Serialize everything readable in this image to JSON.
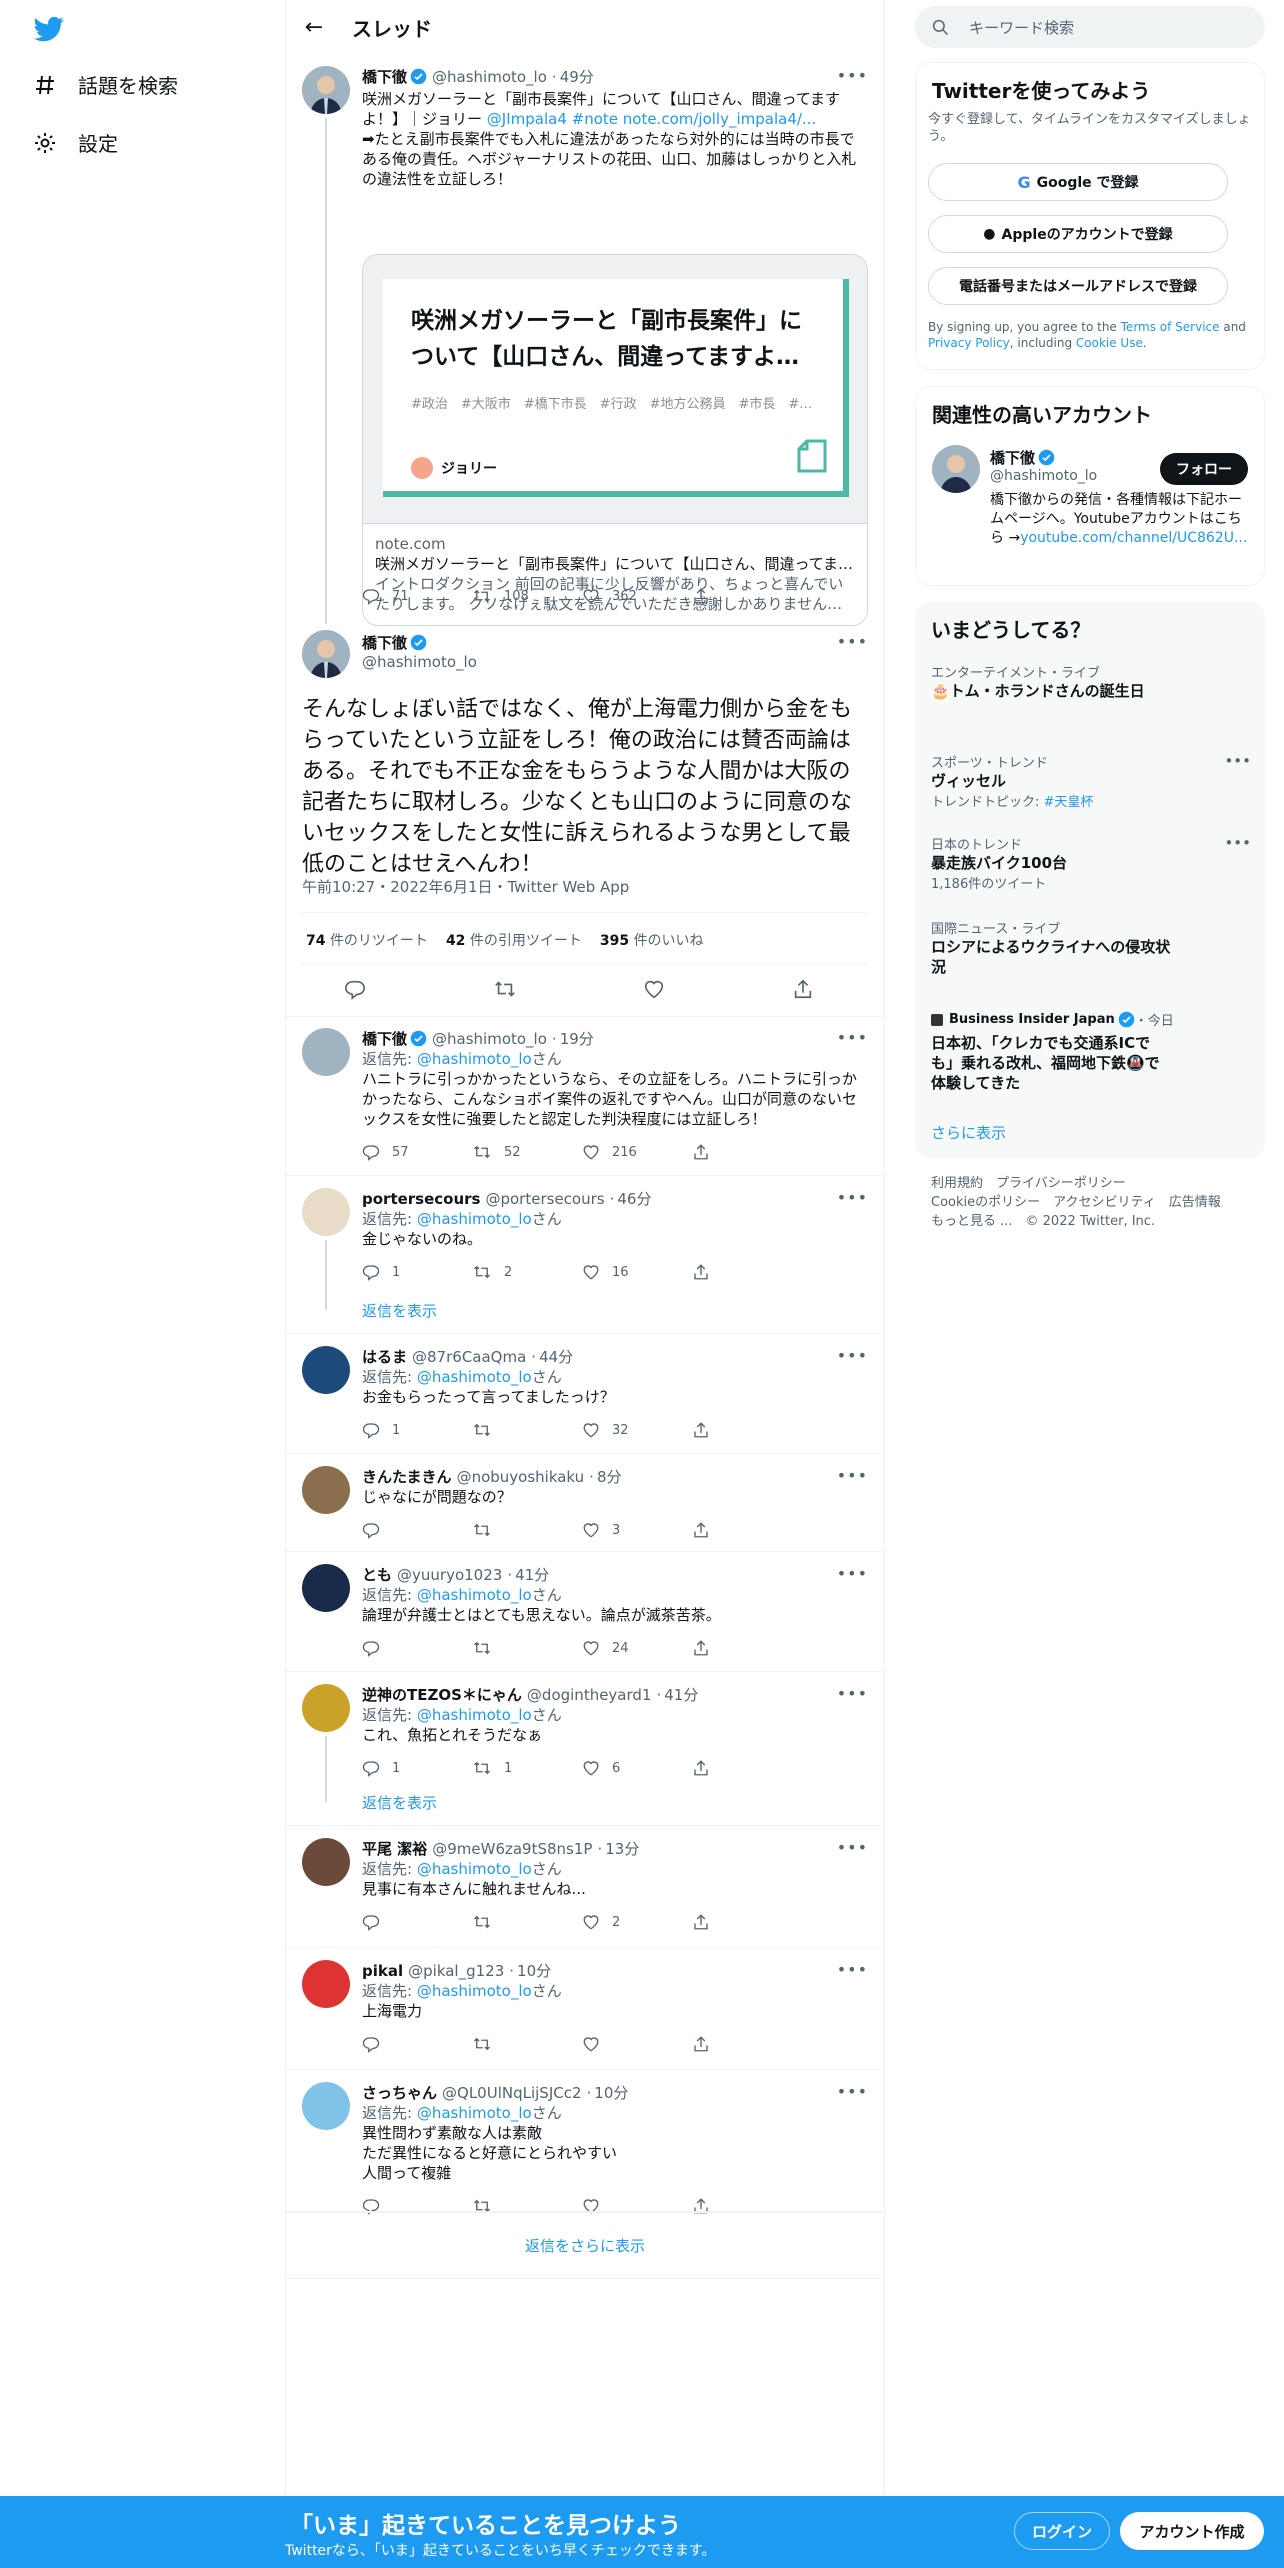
{
  "nav": {
    "explore": "話題を検索",
    "settings": "設定"
  },
  "header": {
    "title": "スレッド"
  },
  "quoted_tweet": {
    "name": "橋下徹",
    "handle": "@hashimoto_lo",
    "time": "49分",
    "text1": "咲洲メガソーラーと「副市長案件」について【山口さん、間違ってますよ！】｜ジョリー ",
    "mention": "@JImpala4",
    "link": " #note note.com/jolly_impala4/...",
    "text2": "➡たとえ副市長案件でも入札に違法があったなら対外的には当時の市長である俺の責任。ヘボジャーナリストの花田、山口、加藤はしっかりと入札の違法性を立証しろ！",
    "card_title": "咲洲メガソーラーと「副市長案件」について【山口さん、間違ってますよ…",
    "card_tags": "#政治　#大阪市　#橋下市長　#行政　#地方公務員　#市長　#…",
    "card_author": "ジョリー",
    "card_domain": "note.com",
    "card_heading": "咲洲メガソーラーと「副市長案件」について【山口さん、間違ってま…",
    "card_desc": "イントロダクション 前回の記事に少し反響があり、ちょっと喜んでいたりします。 クソなげぇ駄文を読んでいただき感謝しかありません…",
    "replies": "71",
    "retweets": "108",
    "likes": "362"
  },
  "main_tweet": {
    "name": "橋下徹",
    "handle": "@hashimoto_lo",
    "text": "そんなしょぼい話ではなく、俺が上海電力側から金をもらっていたという立証をしろ！俺の政治には賛否両論はある。それでも不正な金をもらうような人間かは大阪の記者たちに取材しろ。少なくとも山口のように同意のないセックスをしたと女性に訴えられるような男として最低のことはせえへんわ！",
    "time": "午前10:27・2022年6月1日・Twitter Web App",
    "retweet_count": "74",
    "retweet_label": "件のリツイート",
    "quote_count": "42",
    "quote_label": "件の引用ツイート",
    "like_count": "395",
    "like_label": "件のいいね"
  },
  "replies": [
    {
      "name": "橋下徹",
      "handle": "@hashimoto_lo",
      "time": "19分",
      "reply_to": "@hashimoto_lo",
      "text": "ハニトラに引っかかったというなら、その立証をしろ。ハニトラに引っかかったなら、こんなショボイ案件の返礼ですやへん。山口が同意のないセックスを女性に強要したと認定した判決程度には立証しろ！",
      "replies": "57",
      "retweets": "52",
      "likes": "216"
    },
    {
      "name": "portersecours",
      "handle": "@portersecours",
      "time": "46分",
      "reply_to": "@hashimoto_lo",
      "text": "金じゃないのね。",
      "replies": "1",
      "retweets": "2",
      "likes": "16",
      "show_replies": "返信を表示"
    },
    {
      "name": "はるま",
      "handle": "@87r6CaaQma",
      "time": "44分",
      "reply_to": "@hashimoto_lo",
      "text": "お金もらったって言ってましたっけ？",
      "replies": "1",
      "retweets": "",
      "likes": "32"
    },
    {
      "name": "きんたまきん",
      "handle": "@nobuyoshikaku",
      "time": "8分",
      "reply_to": "",
      "text": "じゃなにが問題なの？",
      "replies": "",
      "retweets": "",
      "likes": "3"
    },
    {
      "name": "とも",
      "handle": "@yuuryo1023",
      "time": "41分",
      "reply_to": "@hashimoto_lo",
      "text": "論理が弁護士とはとても思えない。論点が滅茶苦茶。",
      "replies": "",
      "retweets": "",
      "likes": "24"
    },
    {
      "name": "逆神のTEZOS＊にゃん",
      "handle": "@dogintheyard1",
      "time": "41分",
      "reply_to": "@hashimoto_lo",
      "text": "これ、魚拓とれそうだなぁ",
      "replies": "1",
      "retweets": "1",
      "likes": "6",
      "show_replies": "返信を表示"
    },
    {
      "name": "平尾 潔裕",
      "handle": "@9meW6za9tS8ns1P",
      "time": "13分",
      "reply_to": "@hashimoto_lo",
      "text": "見事に有本さんに触れませんね...",
      "replies": "",
      "retweets": "",
      "likes": "2"
    },
    {
      "name": "pikal",
      "handle": "@pikal_g123",
      "time": "10分",
      "reply_to": "@hashimoto_lo",
      "text": "上海電力",
      "replies": "",
      "retweets": "",
      "likes": ""
    },
    {
      "name": "さっちゃん",
      "handle": "@QL0UlNqLijSJCc2",
      "time": "10分",
      "reply_to": "@hashimoto_lo",
      "text_lines": [
        "異性問わず素敵な人は素敵",
        "ただ異性になると好意にとられやすい",
        "人間って複雑"
      ],
      "replies": "",
      "retweets": "",
      "likes": ""
    }
  ],
  "reply_to_label": "返信先: ",
  "reply_suffix": "さん",
  "show_more_replies": "返信をさらに表示",
  "sidebar": {
    "search_placeholder": "キーワード検索",
    "signup_title": "Twitterを使ってみよう",
    "signup_sub": "今すぐ登録して、タイムラインをカスタマイズしましょう。",
    "google_btn": "Google で登録",
    "apple_btn": "Appleのアカウントで登録",
    "phone_btn": "電話番号またはメールアドレスで登録",
    "terms_pre": "By signing up, you agree to the ",
    "terms": "Terms of Service",
    "terms_and": " and ",
    "privacy": "Privacy Policy",
    "including": ", including ",
    "cookie": "Cookie Use",
    "period": ".",
    "related_title": "関連性の高いアカウント",
    "related_name": "橋下徹",
    "related_handle": "@hashimoto_lo",
    "follow_btn": "フォロー",
    "related_bio": "橋下徹からの発信・各種情報は下記ホームページへ。Youtubeアカウントはこちら →",
    "related_link": "youtube.com/channel/UC862U...",
    "trends_title": "いまどうしてる？",
    "trends": [
      {
        "category": "エンターテイメント・ライブ",
        "title": "🎂トム・ホランドさんの誕生日"
      },
      {
        "category": "スポーツ・トレンド",
        "title": "ヴィッセル",
        "sub_pre": "トレンドトピック: ",
        "sub_link": "#天皇杯"
      },
      {
        "category": "日本のトレンド",
        "title": "暴走族バイク100台",
        "sub": "1,186件のツイート"
      },
      {
        "category": "国際ニュース・ライブ",
        "title": "ロシアによるウクライナへの侵攻状況"
      },
      {
        "source": "Business Insider Japan",
        "time": "・今日",
        "title": "日本初、「クレカでも交通系ICでも」乗れる改札、福岡地下鉄🚇で体験してきた"
      }
    ],
    "show_more": "さらに表示",
    "footer1": "利用規約　プライバシーポリシー",
    "footer2": "Cookieのポリシー　アクセシビリティ　広告情報",
    "footer3": "もっと見る ...　© 2022 Twitter, Inc."
  },
  "bottom": {
    "title": "「いま」起きていることを見つけよう",
    "sub": "Twitterなら、「いま」起きていることをいち早くチェックできます。",
    "login": "ログイン",
    "signup": "アカウント作成"
  },
  "colors": {
    "accent": "#1d9bf0",
    "verified": "#1d9bf0"
  }
}
